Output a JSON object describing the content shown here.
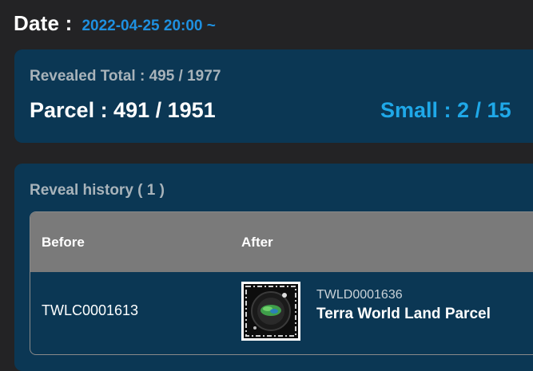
{
  "date": {
    "label": "Date :",
    "value": "2022-04-25 20:00 ~"
  },
  "summary": {
    "revealed_total": "Revealed Total : 495 / 1977",
    "parcel": "Parcel : 491 / 1951",
    "small": "Small : 2 / 15"
  },
  "history": {
    "title": "Reveal history ( 1 )",
    "columns": [
      "Before",
      "After"
    ],
    "rows": [
      {
        "before": "TWLC0001613",
        "after_code": "TWLD0001636",
        "after_name": "Terra World Land Parcel",
        "thumbnail_icon": "land-parcel-nft-icon"
      }
    ]
  },
  "colors": {
    "background": "#232325",
    "card": "#0b3754",
    "accent": "#1fa8e8",
    "table_header": "#7a7a7a"
  }
}
